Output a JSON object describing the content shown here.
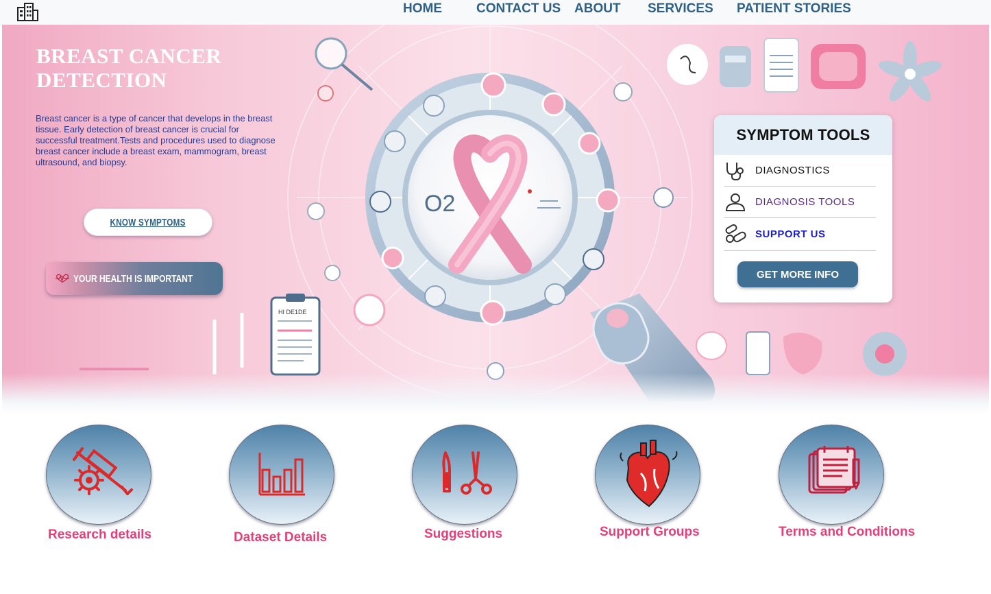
{
  "nav": {
    "logo_icon": "building-icon",
    "items": [
      "HOME",
      "CONTACT US",
      "ABOUT",
      "SERVICES",
      "PATIENT STORIES"
    ]
  },
  "hero": {
    "title": "BREAST CANCER DETECTION",
    "description": "Breast cancer is a type of cancer that develops in the breast tissue. Early detection of breast cancer is crucial for successful treatment.Tests and procedures used to diagnose breast cancer include a breast exam, mammogram, breast ultrasound, and biopsy.",
    "know_button": "KNOW SYMPTOMS",
    "health_button": "YOUR HEALTH IS IMPORTANT",
    "health_icon": "heartbeat-icon",
    "art_text": "O2",
    "clipboard_text": "HI DE1DE"
  },
  "symptom_tools": {
    "title": "SYMPTOM TOOLS",
    "items": [
      {
        "label": "DIAGNOSTICS",
        "icon": "stethoscope-icon",
        "color": "#111111"
      },
      {
        "label": "DIAGNOSIS TOOLS",
        "icon": "user-icon",
        "color": "#5a2a8a"
      },
      {
        "label": "SUPPORT US",
        "icon": "pills-icon",
        "color": "#1f1fcc"
      }
    ],
    "cta": "GET MORE INFO"
  },
  "features": [
    {
      "label": "Research details",
      "icon": "syringe-virus-icon"
    },
    {
      "label": "Dataset Details",
      "icon": "bar-chart-icon"
    },
    {
      "label": "Suggestions",
      "icon": "surgical-tools-icon"
    },
    {
      "label": "Support Groups",
      "icon": "heart-organ-icon"
    },
    {
      "label": "Terms and Conditions",
      "icon": "document-list-icon"
    }
  ],
  "colors": {
    "nav_text": "#2f6186",
    "feature_label": "#e53f7a",
    "icon_red": "#d92b2b",
    "button_blue": "#3f6f93"
  }
}
